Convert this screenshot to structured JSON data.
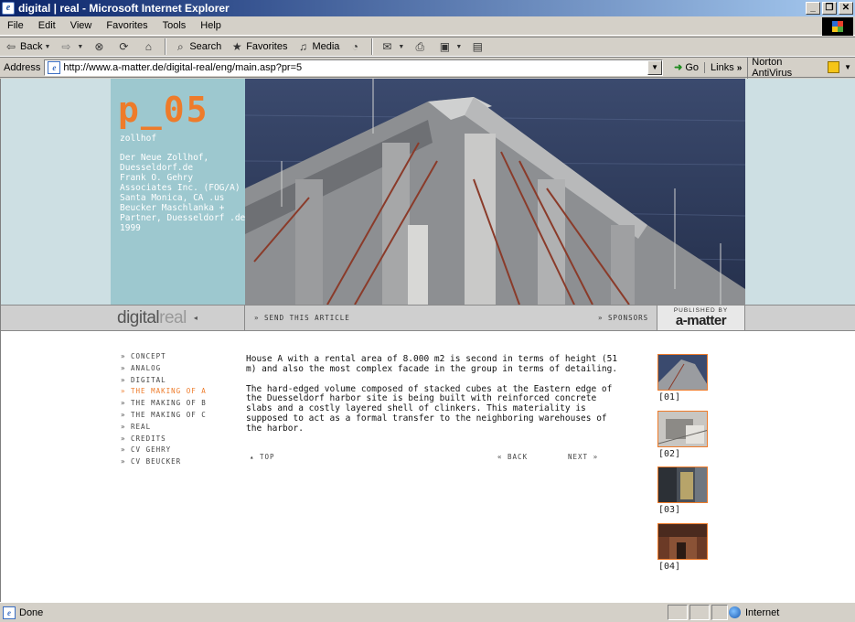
{
  "window": {
    "title": "digital | real - Microsoft Internet Explorer",
    "controls": [
      "_",
      "❐",
      "✕"
    ]
  },
  "menu": [
    "File",
    "Edit",
    "View",
    "Favorites",
    "Tools",
    "Help"
  ],
  "toolbar": {
    "back": "Back",
    "search": "Search",
    "favorites": "Favorites",
    "media": "Media"
  },
  "address": {
    "label": "Address",
    "url": "http://www.a-matter.de/digital-real/eng/main.asp?pr=5",
    "go": "Go",
    "links": "Links",
    "links_more": "»",
    "norton": "Norton AntiVirus"
  },
  "header": {
    "logo": "p_05",
    "subtitle": "zollhof",
    "info": [
      "Der Neue Zollhof,",
      "Duesseldorf.de",
      "Frank O. Gehry",
      "Associates Inc. (FOG/A)",
      "Santa Monica, CA .us",
      "Beucker Maschlanka +",
      "Partner, Duesseldorf .de",
      "1999"
    ]
  },
  "navbar": {
    "brand_1": "digital",
    "brand_2": "real",
    "brand_arrow": "◂",
    "send_article": "» SEND THIS ARTICLE",
    "sponsors": "» SPONSORS",
    "published_by": "PUBLISHED BY",
    "publisher": "a-matter"
  },
  "sidenav": [
    {
      "label": "» CONCEPT",
      "active": false
    },
    {
      "label": "» ANALOG",
      "active": false
    },
    {
      "label": "» DIGITAL",
      "active": false
    },
    {
      "label": "» THE MAKING OF A",
      "active": true
    },
    {
      "label": "» THE MAKING OF B",
      "active": false
    },
    {
      "label": "» THE MAKING OF C",
      "active": false
    },
    {
      "label": "» REAL",
      "active": false
    },
    {
      "label": "» CREDITS",
      "active": false
    },
    {
      "label": "» CV GEHRY",
      "active": false
    },
    {
      "label": "» CV BEUCKER",
      "active": false
    }
  ],
  "article": {
    "paragraphs": [
      "House A with a rental area of 8.000 m2 is second in terms of height (51 m) and also the most complex facade in the group in terms of detailing.",
      "The hard-edged volume composed of stacked cubes at the Eastern edge of the Duesseldorf harbor site is being built with reinforced concrete slabs and a costly layered shell of clinkers. This materiality is supposed to act as a formal transfer to the neighboring warehouses of the harbor."
    ],
    "top": "▴ TOP",
    "back": "« BACK",
    "next": "NEXT »"
  },
  "thumbnails": [
    "[01]",
    "[02]",
    "[03]",
    "[04]"
  ],
  "status": {
    "text": "Done",
    "zone": "Internet"
  },
  "colors": {
    "accent": "#ee7b2a",
    "header_panel": "#9dc8cf",
    "header_band": "#cddfe3",
    "navbar": "#cfcfcf"
  }
}
